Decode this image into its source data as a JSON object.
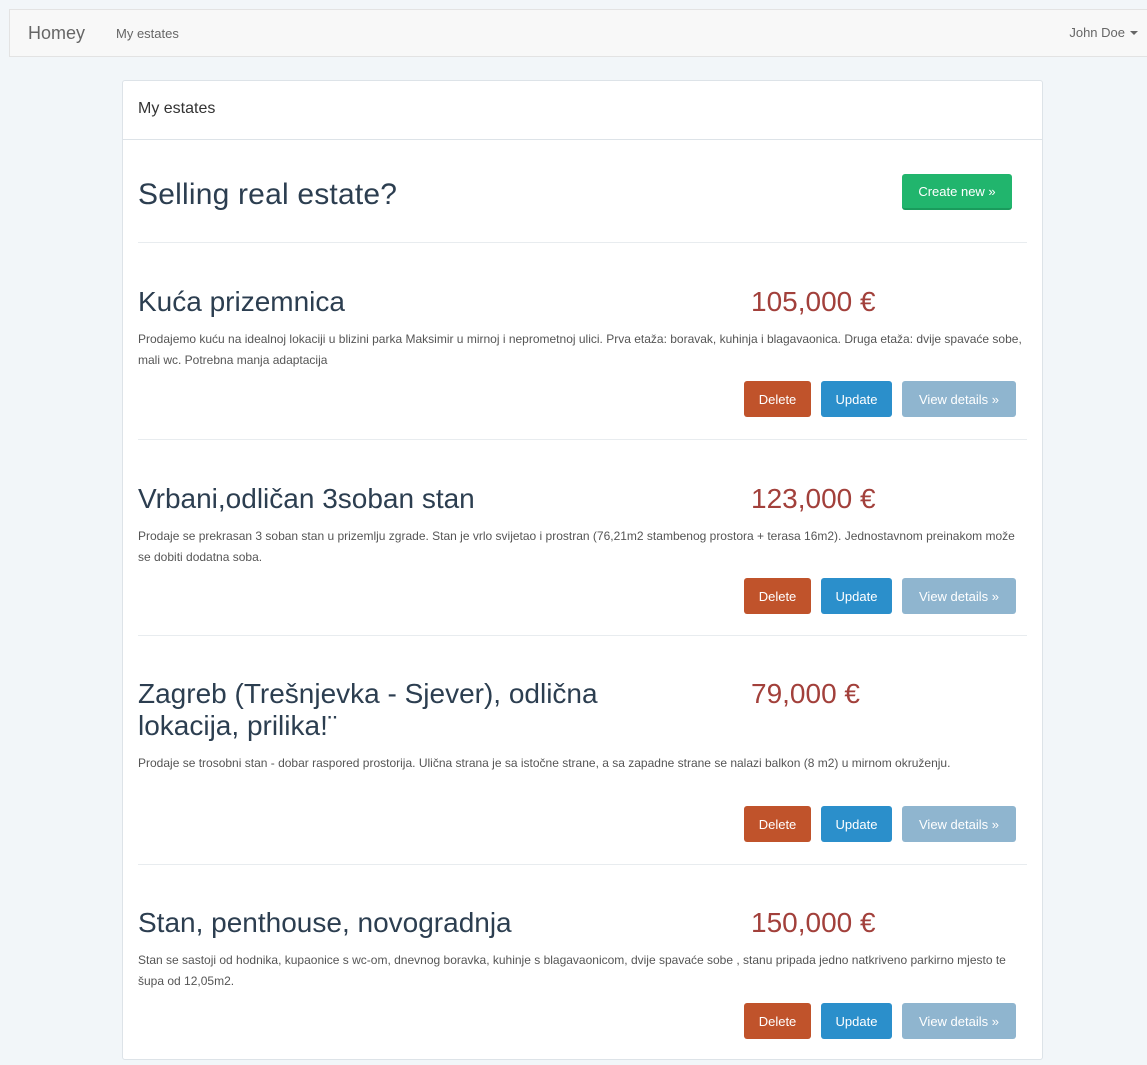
{
  "navbar": {
    "brand": "Homey",
    "link": "My estates",
    "user": "John Doe"
  },
  "panel": {
    "heading": "My estates",
    "hero_title": "Selling real estate?",
    "create_label": "Create new »"
  },
  "buttons": {
    "delete": "Delete",
    "update": "Update",
    "view": "View details »"
  },
  "estates": [
    {
      "title": "Kuća prizemnica",
      "price": "105,000 €",
      "description": "Prodajemo kuću na idealnoj lokaciji u blizini parka Maksimir u mirnoj i neprometnoj ulici. Prva etaža: boravak, kuhinja i blagavaonica. Druga etaža: dvije spavaće sobe, mali wc. Potrebna manja adaptacija"
    },
    {
      "title": "Vrbani,odličan 3soban stan",
      "price": "123,000 €",
      "description": "Prodaje se prekrasan 3 soban stan u prizemlju zgrade. Stan je vrlo svijetao i prostran (76,21m2 stambenog prostora + terasa 16m2). Jednostavnom preinakom može se dobiti dodatna soba."
    },
    {
      "title": "Zagreb (Trešnjevka - Sjever), odlična lokacija, prilika!¨",
      "price": "79,000 €",
      "description": "Prodaje se trosobni stan - dobar raspored prostorija. Ulična strana je sa istočne strane, a sa zapadne strane se nalazi balkon (8 m2) u mirnom okruženju."
    },
    {
      "title": "Stan, penthouse, novogradnja",
      "price": "150,000 €",
      "description": "Stan se sastoji od hodnika, kupaonice s wc-om, dnevnog boravka, kuhinje s blagavaonicom, dvije spavaće sobe , stanu pripada jedno natkriveno parkirno mjesto te šupa od 12,05m2."
    }
  ]
}
